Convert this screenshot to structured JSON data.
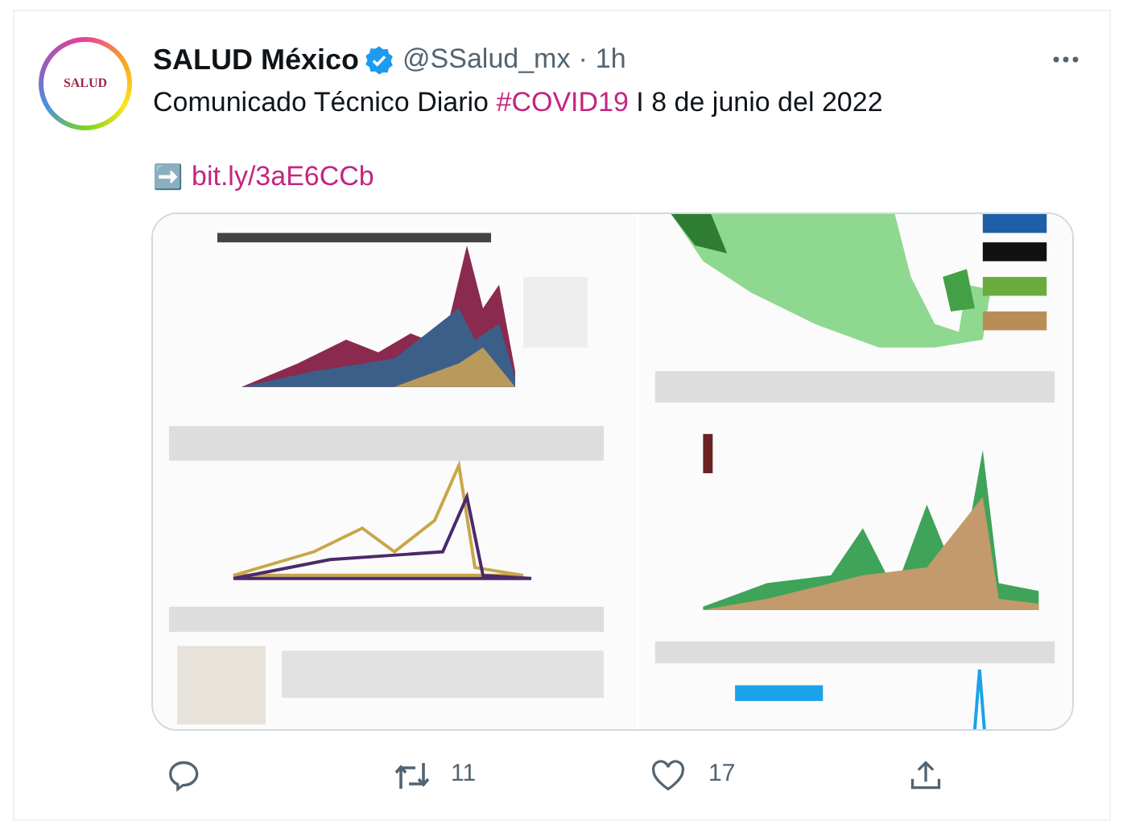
{
  "tweet": {
    "author": {
      "name": "SALUD México",
      "verified": true,
      "handle": "@SSalud_mx",
      "separator": "·",
      "time": "1h"
    },
    "avatar_label": "SALUD",
    "text": [
      {
        "kind": "plain",
        "text": "Comunicado Técnico Diario "
      },
      {
        "kind": "hashtag",
        "text": "#COVID19"
      },
      {
        "kind": "plain",
        "text": " I 8 de junio del 2022"
      }
    ],
    "link": {
      "arrow": "➡️",
      "text": "bit.ly/3aE6CCb"
    },
    "actions": {
      "retweets": "11",
      "likes": "17"
    }
  }
}
